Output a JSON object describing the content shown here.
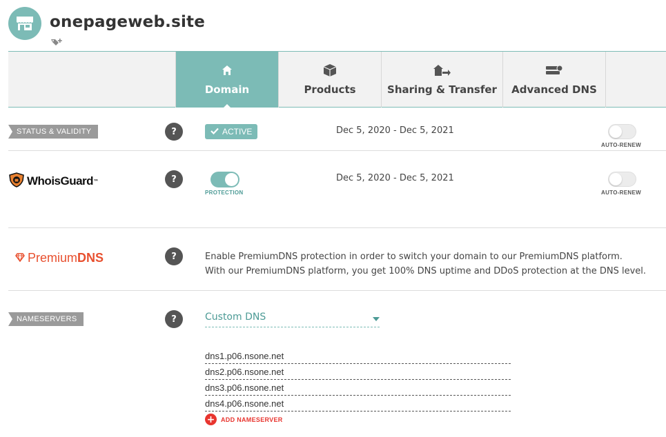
{
  "header": {
    "site_name": "onepageweb.site",
    "avatar_icon": "storefront-icon",
    "tag_icon": "add-tag-icon"
  },
  "tabs": [
    {
      "label": "Domain",
      "icon": "home-icon",
      "active": true
    },
    {
      "label": "Products",
      "icon": "box-icon",
      "active": false
    },
    {
      "label": "Sharing & Transfer",
      "icon": "transfer-icon",
      "active": false
    },
    {
      "label": "Advanced DNS",
      "icon": "server-icon",
      "active": false
    }
  ],
  "status": {
    "tag": "STATUS & VALIDITY",
    "badge": "ACTIVE",
    "dates": "Dec 5, 2020 - Dec 5, 2021",
    "auto_renew_label": "AUTO-RENEW",
    "auto_renew_on": false
  },
  "whoisguard": {
    "logo_text": "WhoisGuard",
    "logo_mark": "™",
    "protection_label": "PROTECTION",
    "protection_on": true,
    "dates": "Dec 5, 2020 - Dec 5, 2021",
    "auto_renew_label": "AUTO-RENEW",
    "auto_renew_on": false
  },
  "premiumdns": {
    "logo_prefix": "Premium",
    "logo_suffix": "DNS",
    "line1": "Enable PremiumDNS protection in order to switch your domain to our PremiumDNS platform.",
    "line2": "With our PremiumDNS platform, you get 100% DNS uptime and DDoS protection at the DNS level."
  },
  "nameservers": {
    "tag": "NAMESERVERS",
    "selected": "Custom DNS",
    "entries": [
      "dns1.p06.nsone.net",
      "dns2.p06.nsone.net",
      "dns3.p06.nsone.net",
      "dns4.p06.nsone.net"
    ],
    "add_label": "ADD NAMESERVER"
  },
  "help_symbol": "?",
  "colors": {
    "accent": "#7cbbb6",
    "premium": "#e8502f",
    "add": "#e8352f",
    "tag": "#9a9a9a"
  }
}
